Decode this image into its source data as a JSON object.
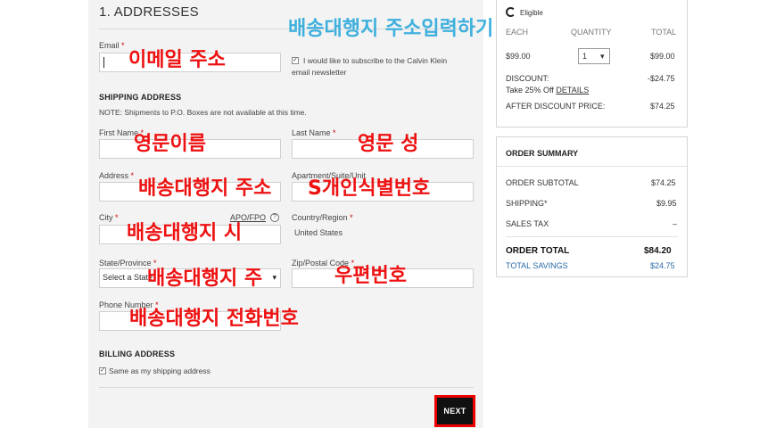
{
  "form": {
    "title": "1. ADDRESSES",
    "email_label": "Email",
    "required_mark": "*",
    "subscribe_text_1": "I would like to subscribe to the Calvin Klein",
    "subscribe_text_2": "email newsletter",
    "subscribe_checked": "✓",
    "shipping_heading": "SHIPPING ADDRESS",
    "shipping_note": "NOTE: Shipments to P.O. Boxes are not available at this time.",
    "first_name_label": "First Name",
    "last_name_label": "Last Name",
    "address_label": "Address",
    "apartment_label": "Apartment/Suite/Unit",
    "city_label": "City",
    "apo_label": "APO/FPO",
    "help_glyph": "?",
    "country_label": "Country/Region",
    "country_value": "United States",
    "state_label": "State/Province",
    "state_value": "Select a State",
    "state_arrow": "▾",
    "zip_label": "Zip/Postal Code",
    "phone_label": "Phone Number",
    "billing_heading": "BILLING ADDRESS",
    "billing_same_text": "Same as my shipping address",
    "billing_checked": "✓",
    "next_label": "NEXT"
  },
  "annotations": {
    "header": "배송대행지 주소입력하기",
    "email": "이메일 주소",
    "first_name": "영문이름",
    "last_name": "영문 성",
    "address": "배송대행지 주소",
    "apartment": "S개인식별번호",
    "city": "배송대행지 시",
    "state": "배송대행지 주",
    "zip": "우편번호",
    "phone": "배송대행지 전화번호"
  },
  "cart": {
    "eligible": "Eligible",
    "col_each": "EACH",
    "col_quantity": "QUANTITY",
    "col_total": "TOTAL",
    "price_each": "$99.00",
    "quantity": "1",
    "qty_arrow": "▾",
    "price_total": "$99.00",
    "discount_label": "DISCOUNT:",
    "discount_value": "-$24.75",
    "discount_desc": "Take 25% Off",
    "details_link": "DETAILS",
    "after_discount_label": "AFTER DISCOUNT PRICE:",
    "after_discount_value": "$74.25"
  },
  "summary": {
    "heading": "ORDER SUMMARY",
    "subtotal_label": "ORDER SUBTOTAL",
    "subtotal_value": "$74.25",
    "shipping_label": "SHIPPING*",
    "shipping_value": "$9.95",
    "tax_label": "SALES TAX",
    "tax_value": "–",
    "total_label": "ORDER TOTAL",
    "total_value": "$84.20",
    "savings_label": "TOTAL SAVINGS",
    "savings_value": "$24.75"
  },
  "colors": {
    "annotation_red": "#ee1111",
    "annotation_blue": "#3fb0dd",
    "highlight_border": "#ee0000",
    "link_blue": "#2a6aa8"
  }
}
